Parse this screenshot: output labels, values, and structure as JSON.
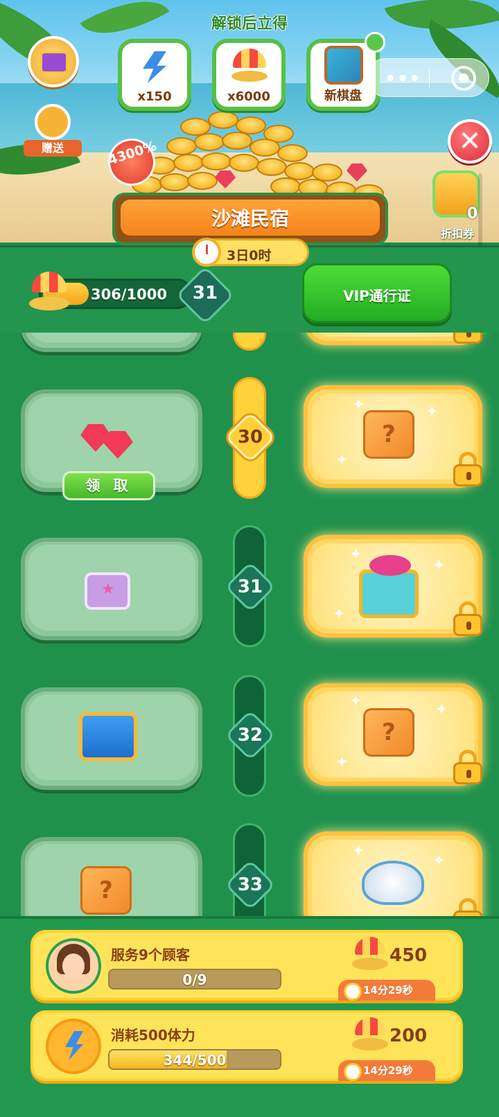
{
  "header": {
    "unlock_title": "解锁后立得",
    "rewards": [
      {
        "icon": "energy-icon",
        "qty": "x150"
      },
      {
        "icon": "beach-umbrella-icon",
        "qty": "x6000"
      },
      {
        "icon": "new-board-icon",
        "qty": "新棋盘"
      }
    ],
    "gift_label": "赠送",
    "bonus_badge": "4300%",
    "coupon_count": "0",
    "coupon_label": "折扣券"
  },
  "event": {
    "title": "沙滩民宿",
    "timer": "3日0时"
  },
  "progress": {
    "value_text": "306/1000",
    "fraction": 0.306,
    "level": "31",
    "vip_button": "VIP通行证"
  },
  "tiers": [
    {
      "level": "30",
      "free_reward": "ruby",
      "vip_reward": "mystery-box",
      "claim_label": "领 取",
      "reached": true
    },
    {
      "level": "31",
      "free_reward": "purple-chest",
      "vip_reward": "treasure-chest",
      "reached": false
    },
    {
      "level": "32",
      "free_reward": "blue-chest",
      "vip_reward": "mystery-box",
      "reached": false
    },
    {
      "level": "33",
      "free_reward": "mystery-box",
      "vip_reward": "shell-dish",
      "reached": false
    }
  ],
  "tasks": [
    {
      "title": "服务9个顾客",
      "progress_text": "0/9",
      "fraction": 0,
      "reward": "450",
      "time_left": "14分29秒"
    },
    {
      "title": "消耗500体力",
      "progress_text": "344/500",
      "fraction": 0.688,
      "reward": "200",
      "time_left": "14分29秒"
    }
  ],
  "icons": {
    "qbox_mark": "?",
    "close": "✕"
  }
}
